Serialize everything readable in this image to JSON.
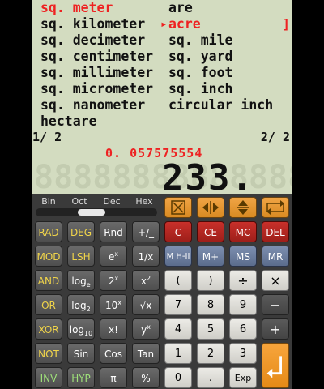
{
  "units": {
    "left": [
      "sq. meter",
      "sq. kilometer",
      "sq. decimeter",
      "sq. centimeter",
      "sq. millimeter",
      "sq. micrometer",
      "sq. nanometer",
      "hectare"
    ],
    "right": [
      "are",
      "acre",
      "sq. mile",
      "sq. yard",
      "sq. foot",
      "sq. inch",
      "circular inch"
    ],
    "marker": "▸",
    "bracket": "]"
  },
  "pages": {
    "left": "1/ 2",
    "right": "2/ 2"
  },
  "result": "0. 057575554",
  "display": {
    "ghost": "88888888888888",
    "value": "233."
  },
  "base_tabs": [
    "Bin",
    "Oct",
    "Dec",
    "Hex"
  ],
  "colors": {
    "lcd": "#d3dcc0",
    "selection_red": "#e22",
    "keypad_bg": "#3a3a3a",
    "enter": "#f7a53c"
  },
  "keys": {
    "rad": "RAD",
    "deg": "DEG",
    "rnd": "Rnd",
    "plusminus": "+/_",
    "mod": "MOD",
    "lsh": "LSH",
    "ex_base": "e",
    "ex_sup": "x",
    "inv_x": "1/x",
    "and": "AND",
    "log_e": "log",
    "log_e_sub": "e",
    "two_x": "2",
    "two_x_sup": "x",
    "x_sq": "x",
    "x_sq_sup": "2",
    "or": "OR",
    "log_2": "log",
    "log_2_sub": "2",
    "ten_x": "10",
    "ten_x_sup": "x",
    "sqrt": "√x",
    "xor": "XOR",
    "log_10": "log",
    "log_10_sub": "10",
    "fact": "x!",
    "y_x": "y",
    "y_x_sup": "x",
    "not": "NOT",
    "sin": "Sin",
    "cos": "Cos",
    "tan": "Tan",
    "inv": "INV",
    "hyp": "HYP",
    "pi": "π",
    "percent": "%",
    "c": "C",
    "ce": "CE",
    "mc": "MC",
    "del": "DEL",
    "mhi": "M H-II",
    "mplus": "M+",
    "ms": "MS",
    "mr": "MR",
    "lparen": "(",
    "rparen": ")",
    "divide": "÷",
    "multiply": "×",
    "d7": "7",
    "d8": "8",
    "d9": "9",
    "minus": "−",
    "d4": "4",
    "d5": "5",
    "d6": "6",
    "plus": "+",
    "d1": "1",
    "d2": "2",
    "d3": "3",
    "d0": "0",
    "dot": ".",
    "exp": "Exp"
  },
  "icons": {
    "clear_icon": "square-x-icon",
    "swap_lr": "left-right-arrows-icon",
    "swap_ud": "up-down-arrows-icon",
    "swap_units": "swap-arrows-icon",
    "enter": "enter-arrow-icon"
  }
}
